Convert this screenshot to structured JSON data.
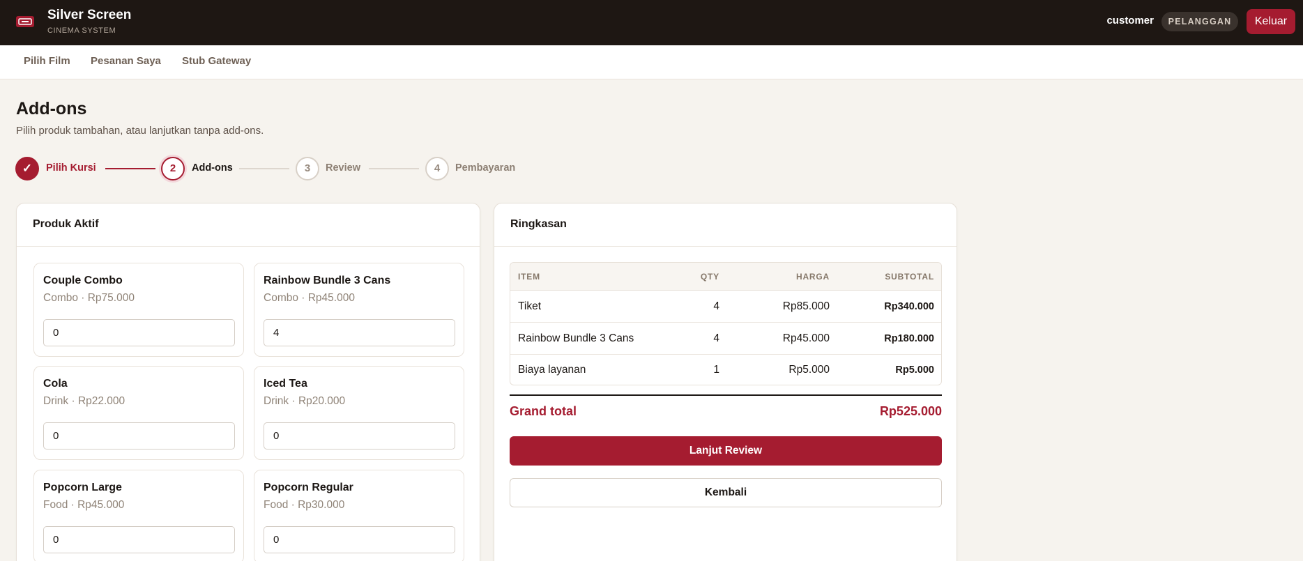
{
  "header": {
    "brand_name": "Silver Screen",
    "brand_sub": "CINEMA SYSTEM",
    "brand_icon": "ticket-icon",
    "user_name": "customer",
    "role": "PELANGGAN",
    "logout_label": "Keluar"
  },
  "nav": {
    "items": [
      {
        "label": "Pilih Film"
      },
      {
        "label": "Pesanan Saya"
      },
      {
        "label": "Stub Gateway"
      }
    ]
  },
  "page": {
    "title": "Add-ons",
    "subtitle": "Pilih produk tambahan, atau lanjutkan tanpa add-ons."
  },
  "steps": [
    {
      "number": "✓",
      "label": "Pilih Kursi",
      "state": "done"
    },
    {
      "number": "2",
      "label": "Add-ons",
      "state": "active"
    },
    {
      "number": "3",
      "label": "Review",
      "state": "todo"
    },
    {
      "number": "4",
      "label": "Pembayaran",
      "state": "todo"
    }
  ],
  "products_card": {
    "title": "Produk Aktif",
    "products": [
      {
        "name": "Couple Combo",
        "meta": "Combo · Rp75.000",
        "qty": "0"
      },
      {
        "name": "Rainbow Bundle 3 Cans",
        "meta": "Combo · Rp45.000",
        "qty": "4"
      },
      {
        "name": "Cola",
        "meta": "Drink · Rp22.000",
        "qty": "0"
      },
      {
        "name": "Iced Tea",
        "meta": "Drink · Rp20.000",
        "qty": "0"
      },
      {
        "name": "Popcorn Large",
        "meta": "Food · Rp45.000",
        "qty": "0"
      },
      {
        "name": "Popcorn Regular",
        "meta": "Food · Rp30.000",
        "qty": "0"
      }
    ]
  },
  "summary_card": {
    "title": "Ringkasan",
    "columns": {
      "item": "ITEM",
      "qty": "QTY",
      "price": "HARGA",
      "subtotal": "SUBTOTAL"
    },
    "rows": [
      {
        "item": "Tiket",
        "qty": "4",
        "price": "Rp85.000",
        "subtotal": "Rp340.000"
      },
      {
        "item": "Rainbow Bundle 3 Cans",
        "qty": "4",
        "price": "Rp45.000",
        "subtotal": "Rp180.000"
      },
      {
        "item": "Biaya layanan",
        "qty": "1",
        "price": "Rp5.000",
        "subtotal": "Rp5.000"
      }
    ],
    "grand_total_label": "Grand total",
    "grand_total_value": "Rp525.000",
    "continue_label": "Lanjut Review",
    "back_label": "Kembali"
  },
  "colors": {
    "accent": "#a51c30",
    "header_bg": "#1e1713",
    "page_bg": "#f6f3ee"
  }
}
